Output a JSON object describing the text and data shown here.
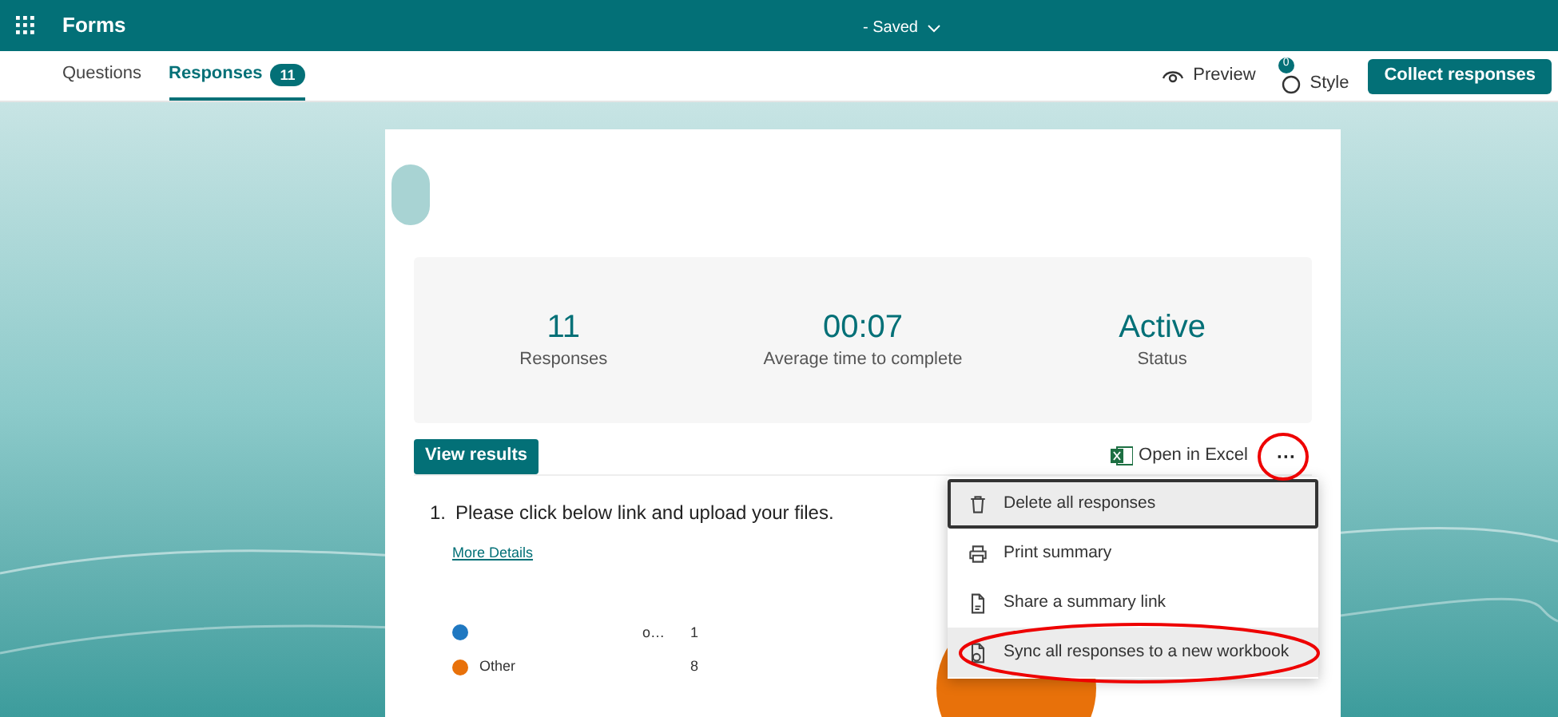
{
  "header": {
    "app_name": "Forms",
    "separator": "-",
    "doc_status": "Saved"
  },
  "tabs": [
    {
      "label": "Questions",
      "selected": false
    },
    {
      "label": "Responses",
      "selected": true,
      "count": "11"
    }
  ],
  "toolbar": {
    "preview": "Preview",
    "style": "Style",
    "style_badge": "0",
    "collect": "Collect responses"
  },
  "stats": [
    {
      "value": "11",
      "label": "Responses"
    },
    {
      "value": "00:07",
      "label": "Average time to complete"
    },
    {
      "value": "Active",
      "label": "Status"
    }
  ],
  "actions": {
    "view_results": "View results",
    "open_in_excel": "Open in Excel",
    "more": "···"
  },
  "menu": [
    {
      "kind": "trash",
      "label": "Delete all responses",
      "selected": true,
      "highlighted": false
    },
    {
      "kind": "print",
      "label": "Print summary",
      "selected": false,
      "highlighted": false
    },
    {
      "kind": "share",
      "label": "Share a summary link",
      "selected": false,
      "highlighted": false
    },
    {
      "kind": "sync",
      "label": "Sync all responses to a new workbook",
      "selected": false,
      "highlighted": true
    }
  ],
  "question": {
    "number": "1.",
    "text": "Please click below link and upload your files.",
    "link": "More Details",
    "legend": [
      {
        "label": "o…",
        "count": "1",
        "color": "#1f78c1"
      },
      {
        "label": "Other",
        "count": "8",
        "color": "#e8710a"
      }
    ]
  }
}
